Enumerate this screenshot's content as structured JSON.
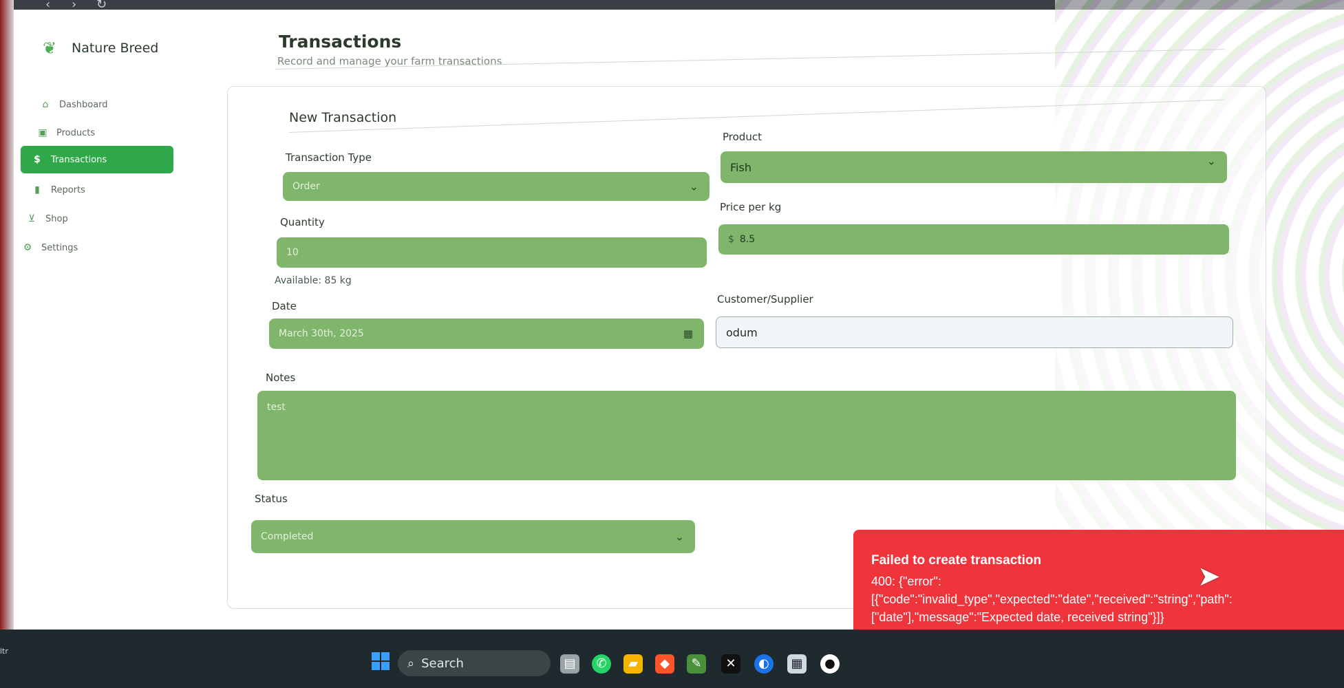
{
  "brand": {
    "name": "Nature Breed",
    "icon": "wheat-leaf-icon"
  },
  "sidebar": {
    "items": [
      {
        "label": "Dashboard",
        "icon": "home-icon",
        "active": false
      },
      {
        "label": "Products",
        "icon": "box-icon",
        "active": false
      },
      {
        "label": "Transactions",
        "icon": "dollar-icon",
        "active": true
      },
      {
        "label": "Reports",
        "icon": "bar-chart-icon",
        "active": false
      },
      {
        "label": "Shop",
        "icon": "cart-icon",
        "active": false
      },
      {
        "label": "Settings",
        "icon": "gear-icon",
        "active": false
      }
    ]
  },
  "header": {
    "title": "Transactions",
    "subtitle": "Record and manage your farm transactions"
  },
  "form": {
    "title": "New Transaction",
    "transaction_type": {
      "label": "Transaction Type",
      "value": "Order"
    },
    "product": {
      "label": "Product",
      "value": "Fish"
    },
    "quantity": {
      "label": "Quantity",
      "value": "10",
      "hint": "Available: 85 kg"
    },
    "price": {
      "label": "Price per kg",
      "currency": "$",
      "value": "8.5"
    },
    "date": {
      "label": "Date",
      "value": "March 30th, 2025"
    },
    "customer": {
      "label": "Customer/Supplier",
      "value": "odum"
    },
    "notes": {
      "label": "Notes",
      "value": "test"
    },
    "status": {
      "label": "Status",
      "value": "Completed"
    }
  },
  "toast": {
    "title": "Failed to create transaction",
    "line1": "400: {\"error\":",
    "line2": "[{\"code\":\"invalid_type\",\"expected\":\"date\",\"received\":\"string\",\"path\":",
    "line3": "[\"date\"],\"message\":\"Expected date, received string\"}]}"
  },
  "taskbar": {
    "search_label": "Search",
    "left_text": "ltr"
  },
  "colors": {
    "accent": "#2fa84a",
    "field": "#80b56c",
    "error": "#f0343c"
  }
}
